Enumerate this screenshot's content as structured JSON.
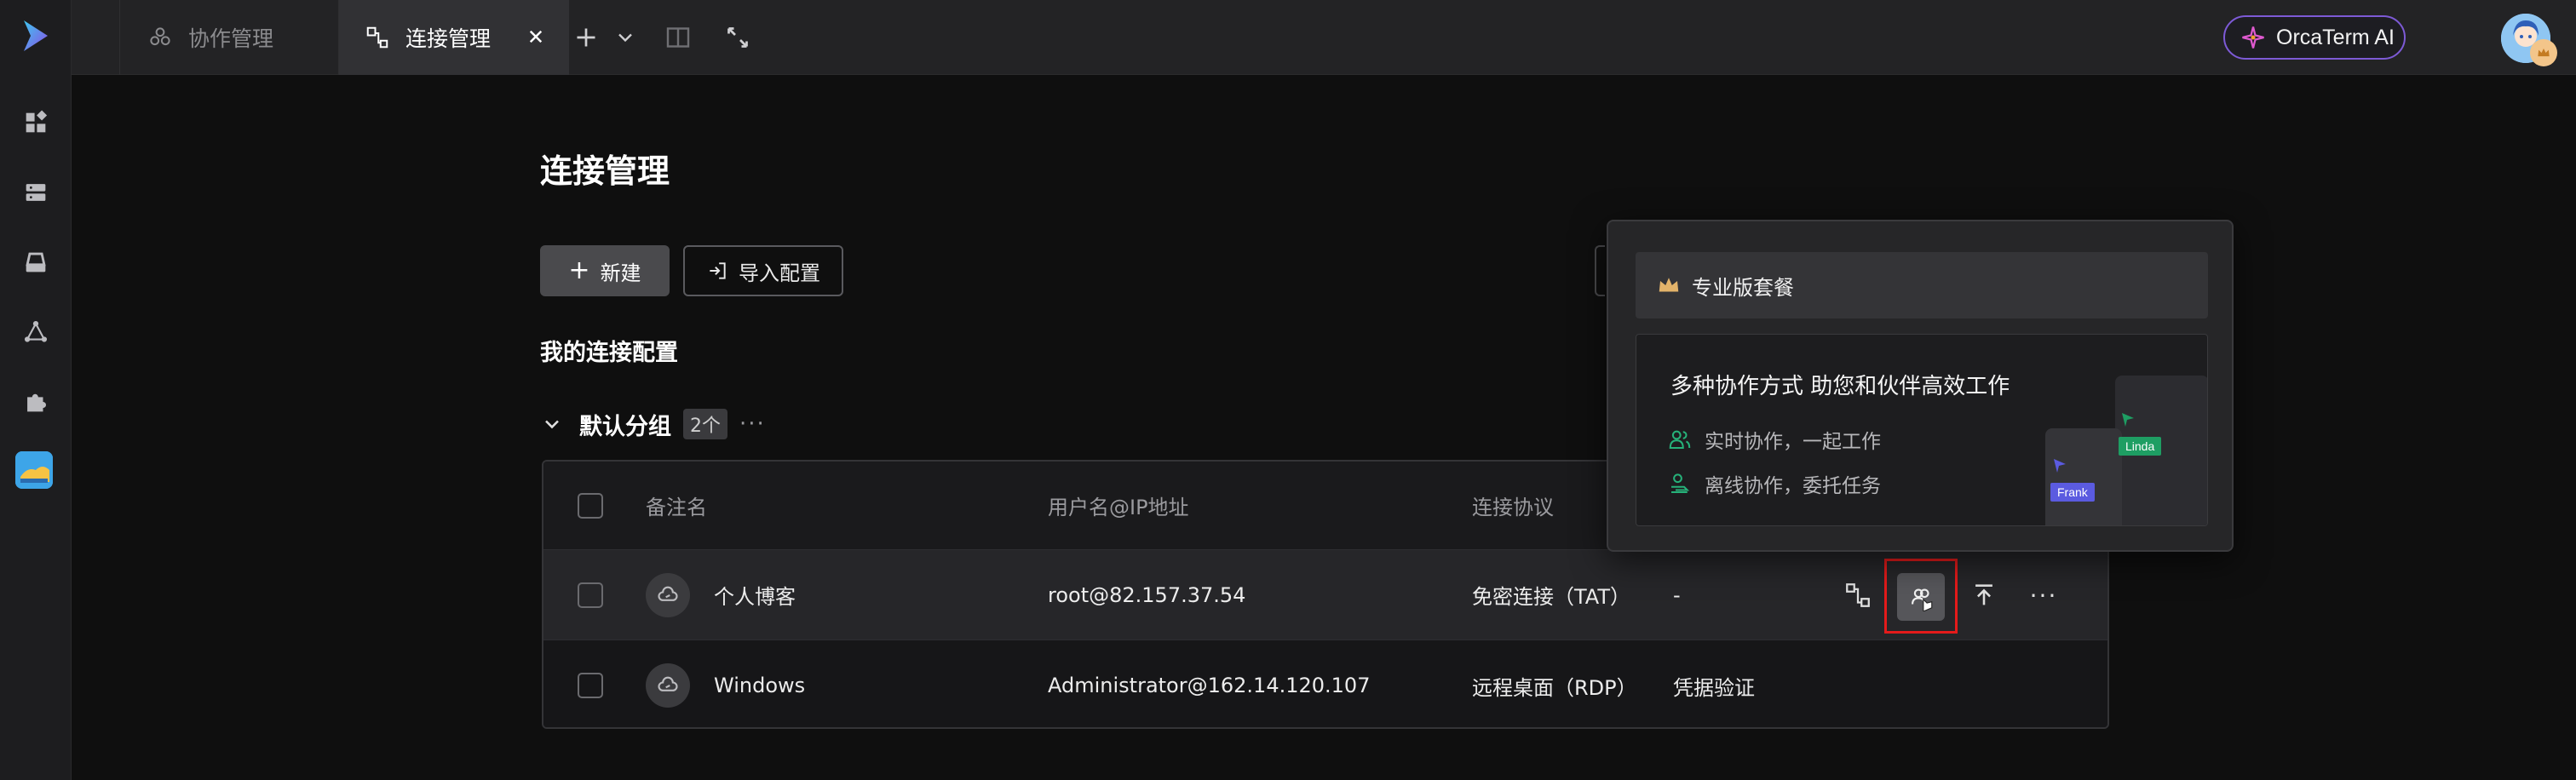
{
  "rail": {
    "items": [
      {
        "name": "dashboard-icon"
      },
      {
        "name": "server-icon"
      },
      {
        "name": "storage-icon"
      },
      {
        "name": "network-icon"
      },
      {
        "name": "plugin-icon"
      }
    ]
  },
  "tabs": [
    {
      "label": "协作管理",
      "active": false
    },
    {
      "label": "连接管理",
      "active": true
    }
  ],
  "header": {
    "ai_label": "OrcaTerm AI"
  },
  "main": {
    "title": "连接管理",
    "new_label": "新建",
    "import_label": "导入配置",
    "section_title": "我的连接配置",
    "group": {
      "name": "默认分组",
      "count": "2个",
      "more": "···"
    }
  },
  "table": {
    "columns": [
      "备注名",
      "用户名@IP地址",
      "连接协议"
    ],
    "rows": [
      {
        "name": "个人博客",
        "address": "root@82.157.37.54",
        "protocol": "免密连接（TAT）",
        "auth": "-"
      },
      {
        "name": "Windows",
        "address": "Administrator@162.14.120.107",
        "protocol": "远程桌面（RDP）",
        "auth": "凭据验证"
      }
    ],
    "more": "···"
  },
  "popover": {
    "header": "专业版套餐",
    "card_title": "多种协作方式 助您和伙伴高效工作",
    "line1": "实时协作，一起工作",
    "line2": "离线协作，委托任务",
    "tag1": "Linda",
    "tag2": "Frank"
  },
  "colors": {
    "accent_purple": "#7d5ad6",
    "highlight_red": "#e51b1b",
    "collab_green": "#1e9e63",
    "collab_blue": "#5b5be0"
  }
}
